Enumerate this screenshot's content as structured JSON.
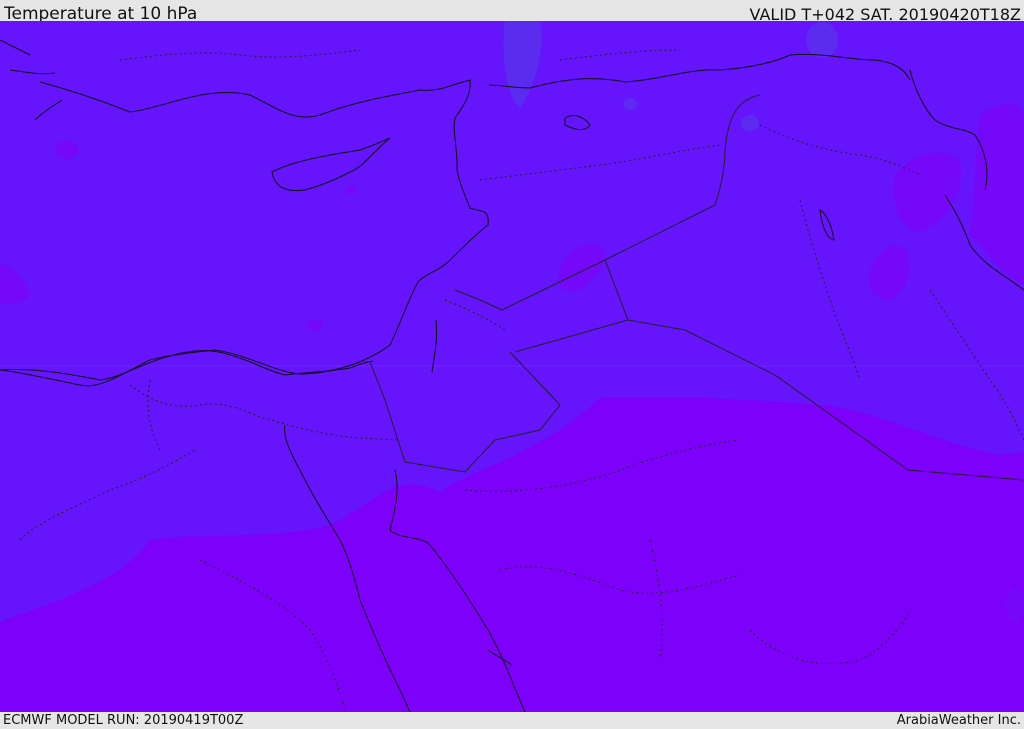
{
  "header": {
    "title": "Temperature at 10 hPa",
    "valid": "VALID T+042 SAT. 20190420T18Z"
  },
  "footer": {
    "model_run": "ECMWF MODEL RUN: 20190419T00Z",
    "credit": "ArabiaWeather Inc."
  },
  "colors": {
    "field_north": "#6514fb",
    "field_south": "#7d00fb",
    "field_warm_patch": "#7508f8",
    "field_cool_patch": "#5b2cf0",
    "coastline": "#111111",
    "border": "#222222"
  }
}
